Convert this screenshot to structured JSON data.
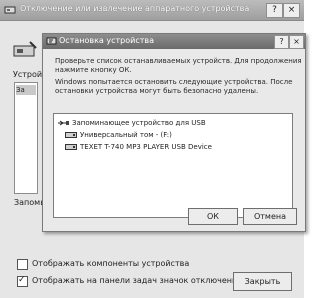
{
  "back_window": {
    "title": "Отключение или извлечение аппаратного устройства",
    "help_button": "?",
    "close_button": "×",
    "devices_label": "Устрой",
    "devices_list_item": "За",
    "footer_label": "Запомы",
    "show_components_label": "Отображать компоненты устройства",
    "show_components_checked": false,
    "show_taskbar_icon_label": "Отображать на панели задач значок отключения",
    "show_taskbar_icon_checked": true,
    "close_label": "Закрыть",
    "check_mark": "✓"
  },
  "front_window": {
    "title": "Остановка устройства",
    "help_button": "?",
    "close_button": "×",
    "instructions": "Проверьте список останавливаемых устройств. Для продолжения нажмите кнопку ОК.",
    "warning": "Windows попытается остановить следующие устройства. После остановки устройства могут быть безопасно удалены.",
    "devices": [
      {
        "label": "Запоминающее устройство для USB",
        "icon": "usb-storage-icon"
      },
      {
        "label": "Универсальный том - (F:)",
        "icon": "drive-icon"
      },
      {
        "label": "TEXET T-740 MP3 PLAYER USB Device",
        "icon": "drive-icon"
      }
    ],
    "ok_label": "ОК",
    "cancel_label": "Отмена"
  }
}
